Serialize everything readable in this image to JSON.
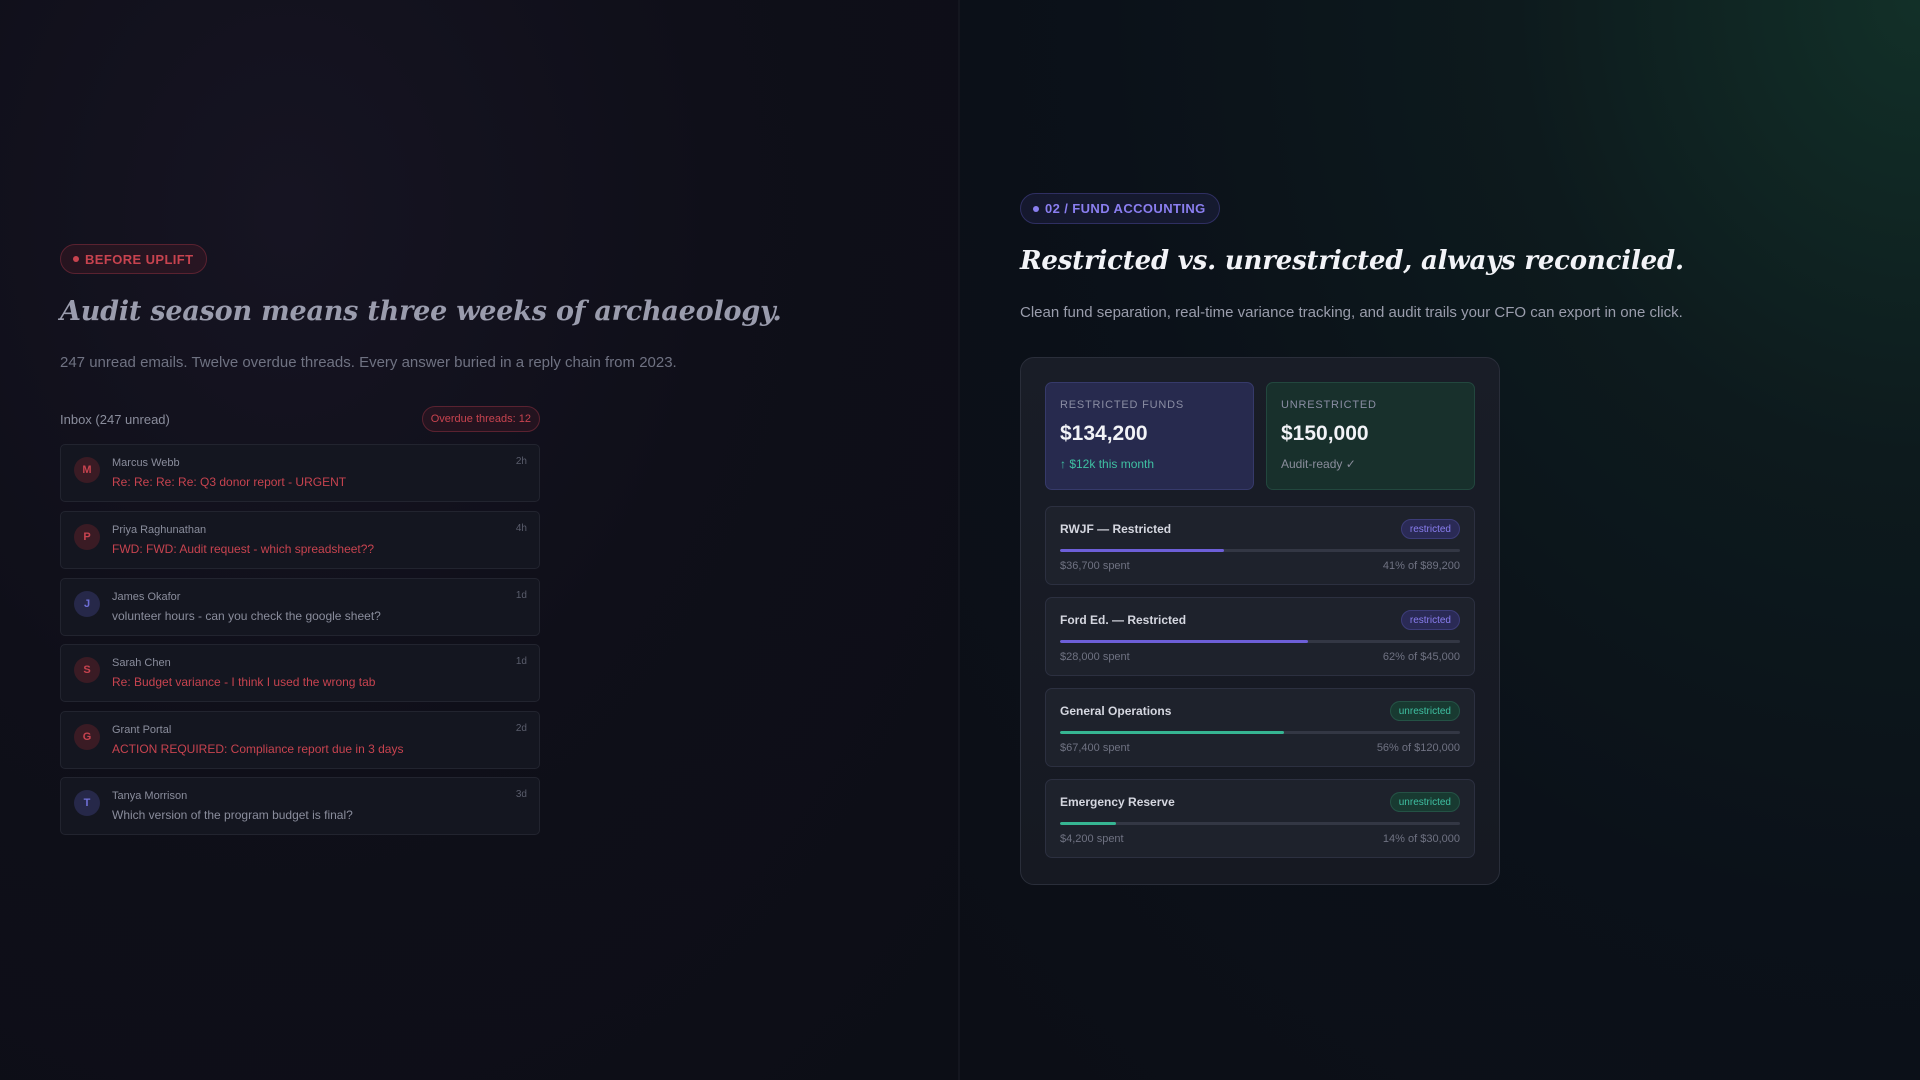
{
  "before": {
    "badge": "BEFORE UPLIFT",
    "title": "Audit season means three weeks of archaeology.",
    "subtitle": "247 unread emails. Twelve overdue threads. Every answer buried in a reply chain from 2023.",
    "inbox_title": "Inbox (247 unread)",
    "overdue_label": "Overdue threads: 12",
    "emails": [
      {
        "initial": "M",
        "sender": "Marcus Webb",
        "subject": "Re: Re: Re: Re: Q3 donor report - URGENT",
        "time": "2h",
        "urgent": true
      },
      {
        "initial": "P",
        "sender": "Priya Raghunathan",
        "subject": "FWD: FWD: Audit request - which spreadsheet??",
        "time": "4h",
        "urgent": true
      },
      {
        "initial": "J",
        "sender": "James Okafor",
        "subject": "volunteer hours - can you check the google sheet?",
        "time": "1d",
        "urgent": false
      },
      {
        "initial": "S",
        "sender": "Sarah Chen",
        "subject": "Re: Budget variance - I think I used the wrong tab",
        "time": "1d",
        "urgent": true
      },
      {
        "initial": "G",
        "sender": "Grant Portal",
        "subject": "ACTION REQUIRED: Compliance report due in 3 days",
        "time": "2d",
        "urgent": true
      },
      {
        "initial": "T",
        "sender": "Tanya Morrison",
        "subject": "Which version of the program budget is final?",
        "time": "3d",
        "urgent": false
      }
    ]
  },
  "after": {
    "badge": "02 / FUND ACCOUNTING",
    "title": "Restricted vs. unrestricted, always reconciled.",
    "subtitle": "Clean fund separation, real-time variance tracking, and audit trails your CFO can export in one click.",
    "stats": {
      "restricted": {
        "label": "RESTRICTED FUNDS",
        "value": "$134,200",
        "note": "↑ $12k this month"
      },
      "unrestricted": {
        "label": "UNRESTRICTED",
        "value": "$150,000",
        "note": "Audit-ready ✓"
      }
    },
    "funds": [
      {
        "name": "RWJF — Restricted",
        "badge": "restricted",
        "kind": "restricted",
        "progress": 0.41,
        "spent": "$36,700 spent",
        "of": "41% of $89,200"
      },
      {
        "name": "Ford Ed. — Restricted",
        "badge": "restricted",
        "kind": "restricted",
        "progress": 0.62,
        "spent": "$28,000 spent",
        "of": "62% of $45,000"
      },
      {
        "name": "General Operations",
        "badge": "unrestricted",
        "kind": "unrestricted",
        "progress": 0.56,
        "spent": "$67,400 spent",
        "of": "56% of $120,000"
      },
      {
        "name": "Emergency Reserve",
        "badge": "unrestricted",
        "kind": "unrestricted",
        "progress": 0.14,
        "spent": "$4,200 spent",
        "of": "14% of $30,000"
      }
    ]
  },
  "colors": {
    "urgent_red": "#c7434f",
    "restricted_purple": "#6d5fd8",
    "unrestricted_teal": "#36b592"
  }
}
